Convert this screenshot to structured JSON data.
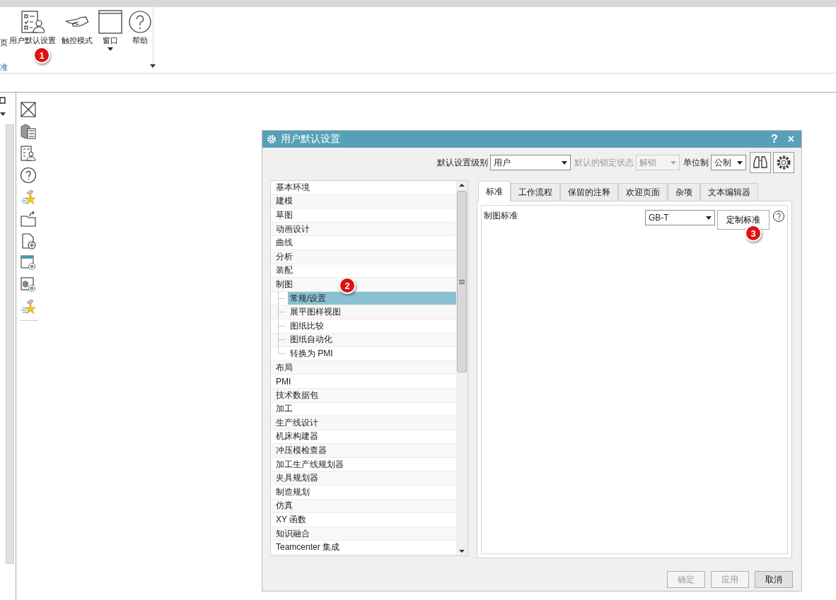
{
  "ribbon": {
    "cut_label": "页",
    "items": [
      {
        "kind": "user-settings",
        "label": "用户默认设置",
        "has_menu": false
      },
      {
        "kind": "touch",
        "label": "触控模式",
        "has_menu": false
      },
      {
        "kind": "window",
        "label": "窗口",
        "has_menu": true
      },
      {
        "kind": "help",
        "label": "帮助",
        "has_menu": false
      }
    ],
    "group_label": "准"
  },
  "dialog": {
    "title": "用户默认设置",
    "help": "?",
    "close": "×",
    "level_label": "默认设置级别",
    "level_value": "用户",
    "lock_label": "默认的锁定状态",
    "lock_value": "解锁",
    "lock_disabled": true,
    "unit_label": "单位制",
    "unit_value": "公制",
    "tree": [
      {
        "label": "基本环境",
        "selected": false
      },
      {
        "label": "建模",
        "selected": false
      },
      {
        "label": "草图",
        "selected": false
      },
      {
        "label": "动画设计",
        "selected": false
      },
      {
        "label": "曲线",
        "selected": false
      },
      {
        "label": "分析",
        "selected": false
      },
      {
        "label": "装配",
        "selected": false
      },
      {
        "label": "制图",
        "selected": false,
        "expanded": true,
        "children": [
          {
            "label": "常规/设置",
            "selected": true
          },
          {
            "label": "展平图样视图",
            "selected": false
          },
          {
            "label": "图纸比较",
            "selected": false
          },
          {
            "label": "图纸自动化",
            "selected": false
          },
          {
            "label": "转换为 PMI",
            "selected": false
          }
        ]
      },
      {
        "label": "布局",
        "selected": false
      },
      {
        "label": "PMI",
        "selected": false
      },
      {
        "label": "技术数据包",
        "selected": false
      },
      {
        "label": "加工",
        "selected": false
      },
      {
        "label": "生产线设计",
        "selected": false
      },
      {
        "label": "机床构建器",
        "selected": false
      },
      {
        "label": "冲压模检查器",
        "selected": false
      },
      {
        "label": "加工生产线规划器",
        "selected": false
      },
      {
        "label": "夹具规划器",
        "selected": false
      },
      {
        "label": "制造规划",
        "selected": false
      },
      {
        "label": "仿真",
        "selected": false
      },
      {
        "label": "XY 函数",
        "selected": false
      },
      {
        "label": "知识融合",
        "selected": false
      },
      {
        "label": "Teamcenter 集成",
        "selected": false
      }
    ],
    "tabs": [
      {
        "label": "标准",
        "selected": true
      },
      {
        "label": "工作流程",
        "selected": false
      },
      {
        "label": "保留的注释",
        "selected": false
      },
      {
        "label": "欢迎页面",
        "selected": false
      },
      {
        "label": "杂项",
        "selected": false
      },
      {
        "label": "文本编辑器",
        "selected": false
      }
    ],
    "standard_label": "制图标准",
    "standard_value": "GB-T",
    "customize_button": "定制标准",
    "buttons": [
      {
        "label": "确定",
        "disabled": true
      },
      {
        "label": "应用",
        "disabled": true
      },
      {
        "label": "取消",
        "disabled": false
      }
    ]
  },
  "annotations": [
    {
      "kind": "ribbon",
      "number": "1"
    },
    {
      "kind": "tree",
      "number": "2"
    },
    {
      "kind": "customize",
      "number": "3"
    }
  ]
}
